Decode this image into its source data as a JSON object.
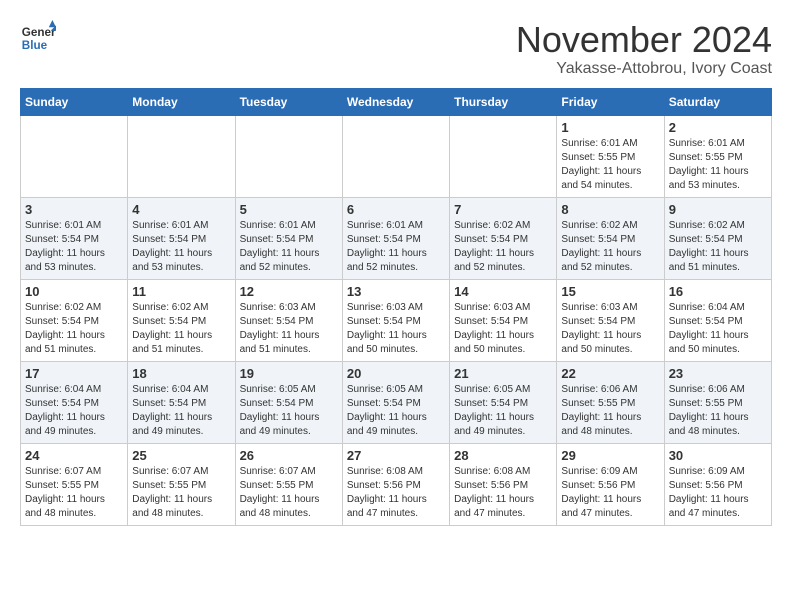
{
  "header": {
    "logo_line1": "General",
    "logo_line2": "Blue",
    "month": "November 2024",
    "location": "Yakasse-Attobrou, Ivory Coast"
  },
  "days_of_week": [
    "Sunday",
    "Monday",
    "Tuesday",
    "Wednesday",
    "Thursday",
    "Friday",
    "Saturday"
  ],
  "weeks": [
    [
      {
        "day": "",
        "info": ""
      },
      {
        "day": "",
        "info": ""
      },
      {
        "day": "",
        "info": ""
      },
      {
        "day": "",
        "info": ""
      },
      {
        "day": "",
        "info": ""
      },
      {
        "day": "1",
        "info": "Sunrise: 6:01 AM\nSunset: 5:55 PM\nDaylight: 11 hours\nand 54 minutes."
      },
      {
        "day": "2",
        "info": "Sunrise: 6:01 AM\nSunset: 5:55 PM\nDaylight: 11 hours\nand 53 minutes."
      }
    ],
    [
      {
        "day": "3",
        "info": "Sunrise: 6:01 AM\nSunset: 5:54 PM\nDaylight: 11 hours\nand 53 minutes."
      },
      {
        "day": "4",
        "info": "Sunrise: 6:01 AM\nSunset: 5:54 PM\nDaylight: 11 hours\nand 53 minutes."
      },
      {
        "day": "5",
        "info": "Sunrise: 6:01 AM\nSunset: 5:54 PM\nDaylight: 11 hours\nand 52 minutes."
      },
      {
        "day": "6",
        "info": "Sunrise: 6:01 AM\nSunset: 5:54 PM\nDaylight: 11 hours\nand 52 minutes."
      },
      {
        "day": "7",
        "info": "Sunrise: 6:02 AM\nSunset: 5:54 PM\nDaylight: 11 hours\nand 52 minutes."
      },
      {
        "day": "8",
        "info": "Sunrise: 6:02 AM\nSunset: 5:54 PM\nDaylight: 11 hours\nand 52 minutes."
      },
      {
        "day": "9",
        "info": "Sunrise: 6:02 AM\nSunset: 5:54 PM\nDaylight: 11 hours\nand 51 minutes."
      }
    ],
    [
      {
        "day": "10",
        "info": "Sunrise: 6:02 AM\nSunset: 5:54 PM\nDaylight: 11 hours\nand 51 minutes."
      },
      {
        "day": "11",
        "info": "Sunrise: 6:02 AM\nSunset: 5:54 PM\nDaylight: 11 hours\nand 51 minutes."
      },
      {
        "day": "12",
        "info": "Sunrise: 6:03 AM\nSunset: 5:54 PM\nDaylight: 11 hours\nand 51 minutes."
      },
      {
        "day": "13",
        "info": "Sunrise: 6:03 AM\nSunset: 5:54 PM\nDaylight: 11 hours\nand 50 minutes."
      },
      {
        "day": "14",
        "info": "Sunrise: 6:03 AM\nSunset: 5:54 PM\nDaylight: 11 hours\nand 50 minutes."
      },
      {
        "day": "15",
        "info": "Sunrise: 6:03 AM\nSunset: 5:54 PM\nDaylight: 11 hours\nand 50 minutes."
      },
      {
        "day": "16",
        "info": "Sunrise: 6:04 AM\nSunset: 5:54 PM\nDaylight: 11 hours\nand 50 minutes."
      }
    ],
    [
      {
        "day": "17",
        "info": "Sunrise: 6:04 AM\nSunset: 5:54 PM\nDaylight: 11 hours\nand 49 minutes."
      },
      {
        "day": "18",
        "info": "Sunrise: 6:04 AM\nSunset: 5:54 PM\nDaylight: 11 hours\nand 49 minutes."
      },
      {
        "day": "19",
        "info": "Sunrise: 6:05 AM\nSunset: 5:54 PM\nDaylight: 11 hours\nand 49 minutes."
      },
      {
        "day": "20",
        "info": "Sunrise: 6:05 AM\nSunset: 5:54 PM\nDaylight: 11 hours\nand 49 minutes."
      },
      {
        "day": "21",
        "info": "Sunrise: 6:05 AM\nSunset: 5:54 PM\nDaylight: 11 hours\nand 49 minutes."
      },
      {
        "day": "22",
        "info": "Sunrise: 6:06 AM\nSunset: 5:55 PM\nDaylight: 11 hours\nand 48 minutes."
      },
      {
        "day": "23",
        "info": "Sunrise: 6:06 AM\nSunset: 5:55 PM\nDaylight: 11 hours\nand 48 minutes."
      }
    ],
    [
      {
        "day": "24",
        "info": "Sunrise: 6:07 AM\nSunset: 5:55 PM\nDaylight: 11 hours\nand 48 minutes."
      },
      {
        "day": "25",
        "info": "Sunrise: 6:07 AM\nSunset: 5:55 PM\nDaylight: 11 hours\nand 48 minutes."
      },
      {
        "day": "26",
        "info": "Sunrise: 6:07 AM\nSunset: 5:55 PM\nDaylight: 11 hours\nand 48 minutes."
      },
      {
        "day": "27",
        "info": "Sunrise: 6:08 AM\nSunset: 5:56 PM\nDaylight: 11 hours\nand 47 minutes."
      },
      {
        "day": "28",
        "info": "Sunrise: 6:08 AM\nSunset: 5:56 PM\nDaylight: 11 hours\nand 47 minutes."
      },
      {
        "day": "29",
        "info": "Sunrise: 6:09 AM\nSunset: 5:56 PM\nDaylight: 11 hours\nand 47 minutes."
      },
      {
        "day": "30",
        "info": "Sunrise: 6:09 AM\nSunset: 5:56 PM\nDaylight: 11 hours\nand 47 minutes."
      }
    ]
  ]
}
